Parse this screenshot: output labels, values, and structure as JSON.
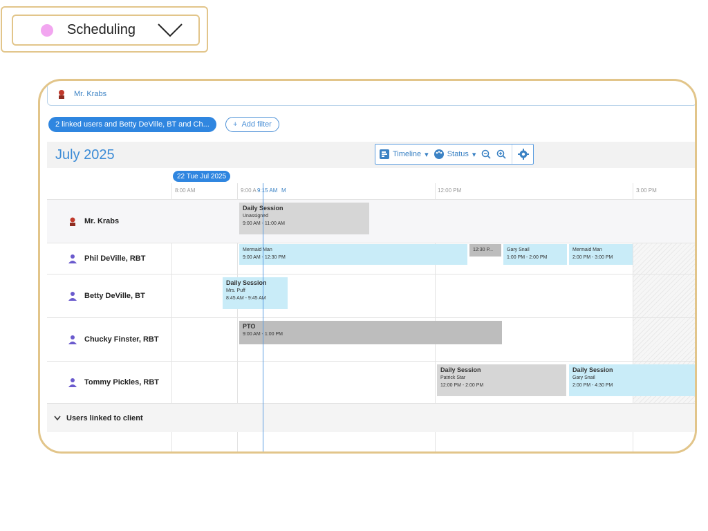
{
  "module_selector": {
    "label": "Scheduling",
    "dot_color": "#f2a6f0"
  },
  "client_bar": {
    "name": "Mr. Krabs"
  },
  "filters": {
    "active_chip": "2 linked users and Betty DeVille, BT and Ch...",
    "add_label": "Add filter"
  },
  "toolbar": {
    "month": "July 2025",
    "view_label": "Timeline",
    "status_label": "Status"
  },
  "timeline": {
    "date_chip": "22 Tue Jul 2025",
    "ticks": [
      "8:00 AM",
      "9:00 A",
      "9:15 AM",
      "M",
      "12:00 PM",
      "3:00 PM"
    ]
  },
  "rows": [
    {
      "name": "Mr. Krabs"
    },
    {
      "name": "Phil DeVille, RBT"
    },
    {
      "name": "Betty DeVille, BT"
    },
    {
      "name": "Chucky Finster, RBT"
    },
    {
      "name": "Tommy Pickles, RBT"
    }
  ],
  "events": {
    "krabs_session": {
      "title": "Daily Session",
      "who": "Unassigned",
      "time": "9:00 AM - 11:00 AM"
    },
    "phil_mermaid1": {
      "who": "Mermaid Man",
      "time": "9:00 AM - 12:30 PM"
    },
    "phil_small": {
      "time": "12:30 P..."
    },
    "phil_gary": {
      "who": "Gary Snail",
      "time": "1:00 PM - 2:00 PM"
    },
    "phil_mermaid2": {
      "who": "Mermaid Man",
      "time": "2:00 PM - 3:00 PM"
    },
    "betty_session": {
      "title": "Daily Session",
      "who": "Mrs. Puff",
      "time": "8:45 AM - 9:45 AM"
    },
    "chucky_pto": {
      "title": "PTO",
      "time": "9:00 AM - 1:00 PM"
    },
    "tommy_patrick": {
      "title": "Daily Session",
      "who": "Patrick Star",
      "time": "12:00 PM - 2:00 PM"
    },
    "tommy_gary": {
      "title": "Daily Session",
      "who": "Gary Snail",
      "time": "2:00 PM - 4:30 PM"
    }
  },
  "collapsed_group": {
    "label": "Users linked to client"
  }
}
